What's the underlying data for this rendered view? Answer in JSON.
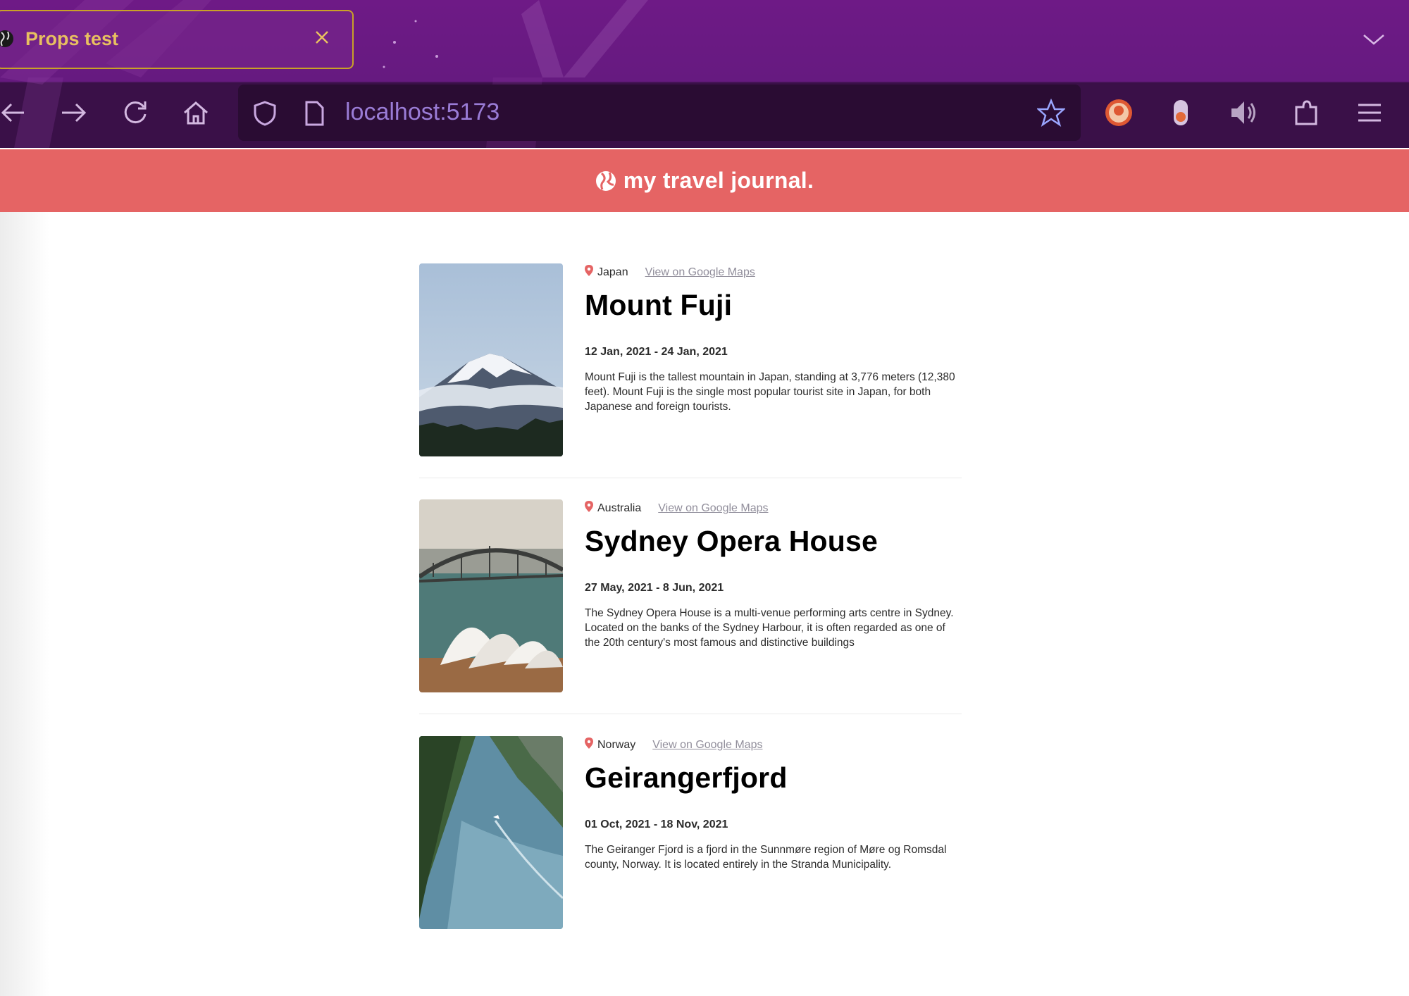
{
  "browser": {
    "tab_title": "Props test",
    "url": "localhost:5173"
  },
  "header": {
    "brand": "my travel journal.",
    "brand_color": "#e56464"
  },
  "entries": [
    {
      "country": "Japan",
      "map_link": "View on Google Maps",
      "title": "Mount Fuji",
      "dates": "12 Jan, 2021 - 24 Jan, 2021",
      "description": "Mount Fuji is the tallest mountain in Japan, standing at 3,776 meters (12,380 feet). Mount Fuji is the single most popular tourist site in Japan, for both Japanese and foreign tourists."
    },
    {
      "country": "Australia",
      "map_link": "View on Google Maps",
      "title": "Sydney Opera House",
      "dates": "27 May, 2021 - 8 Jun, 2021",
      "description": "The Sydney Opera House is a multi-venue performing arts centre in Sydney. Located on the banks of the Sydney Harbour, it is often regarded as one of the 20th century's most famous and distinctive buildings"
    },
    {
      "country": "Norway",
      "map_link": "View on Google Maps",
      "title": "Geirangerfjord",
      "dates": "01 Oct, 2021 - 18 Nov, 2021",
      "description": "The Geiranger Fjord is a fjord in the Sunnmøre region of Møre og Romsdal county, Norway. It is located entirely in the Stranda Municipality."
    }
  ],
  "icons": {
    "pin_color": "#e56464"
  }
}
